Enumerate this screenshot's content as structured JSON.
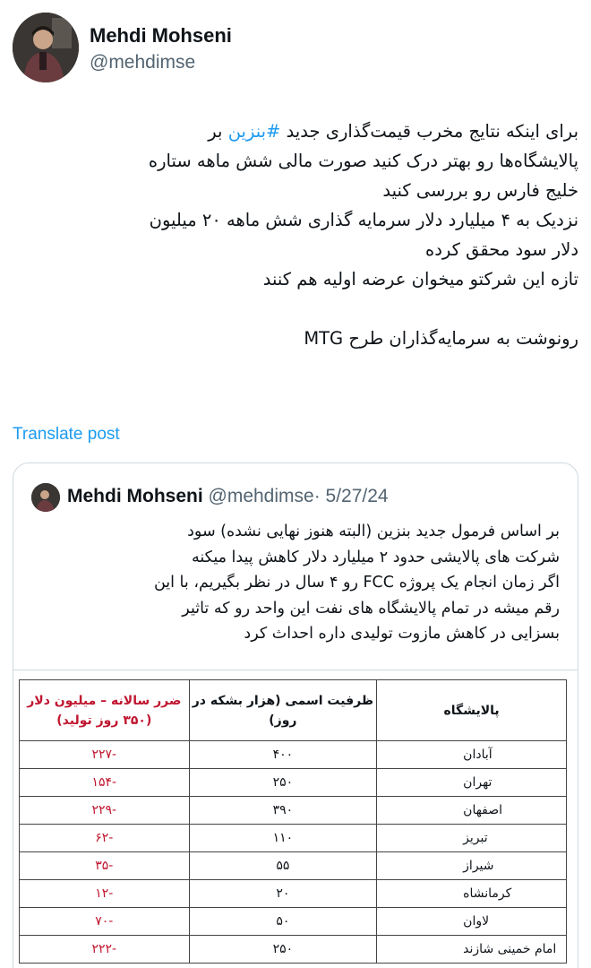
{
  "post": {
    "author_name": "Mehdi Mohseni",
    "author_handle": "@mehdimse",
    "text_lines": [
      {
        "before": "برای اینکه نتایج مخرب قیمت‌گذاری جدید ",
        "hashtag": "#بنزین",
        "after": " بر"
      },
      "پالایشگاه‌ها رو بهتر درک کنید صورت مالی شش ماهه ستاره",
      "خلیج فارس رو بررسی کنید",
      "نزدیک به ۴ میلیارد دلار سرمایه گذاری شش ماهه ۲۰ میلیون",
      "دلار سود محقق کرده",
      "تازه این شرکتو میخوان عرضه اولیه هم کنند",
      "رونوشت به سرمایه‌گذاران طرح MTG"
    ],
    "translate_label": "Translate post"
  },
  "quote": {
    "author_name": "Mehdi Mohseni",
    "author_handle": "@mehdimse",
    "separator": "·",
    "date": "5/27/24",
    "text_lines": [
      "بر اساس فرمول جدید بنزین (البته هنوز نهایی نشده) سود",
      "شرکت های پالایشی حدود ۲ میلیارد دلار کاهش پیدا میکنه",
      "اگر زمان انجام یک پروژه FCC رو ۴ سال در نظر بگیریم، با این",
      "رقم میشه در تمام پالایشگاه های نفت این واحد رو که تاثیر",
      "بسزایی در کاهش مازوت تولیدی داره احداث کرد"
    ],
    "table": {
      "headers": {
        "refinery": "پالایشگاه",
        "capacity": "ظرفیت اسمی (هزار بشکه در روز)",
        "loss": "ضرر سالانه – میلیون دلار (۳۵۰ روز تولید)"
      },
      "rows": [
        {
          "name": "آبادان",
          "capacity": "۴۰۰",
          "loss": "-۲۲۷"
        },
        {
          "name": "تهران",
          "capacity": "۲۵۰",
          "loss": "-۱۵۴"
        },
        {
          "name": "اصفهان",
          "capacity": "۳۹۰",
          "loss": "-۲۲۹"
        },
        {
          "name": "تبریز",
          "capacity": "۱۱۰",
          "loss": "-۶۲"
        },
        {
          "name": "شیراز",
          "capacity": "۵۵",
          "loss": "-۳۵"
        },
        {
          "name": "کرمانشاه",
          "capacity": "۲۰",
          "loss": "-۱۲"
        },
        {
          "name": "لاوان",
          "capacity": "۵۰",
          "loss": "-۷۰"
        },
        {
          "name": "امام خمینی شازند",
          "capacity": "۲۵۰",
          "loss": "-۲۲۲"
        }
      ]
    }
  },
  "colors": {
    "link": "#1d9bf0",
    "secondary_text": "#536471",
    "loss_red": "#c0152f",
    "border": "#cfd9de"
  }
}
